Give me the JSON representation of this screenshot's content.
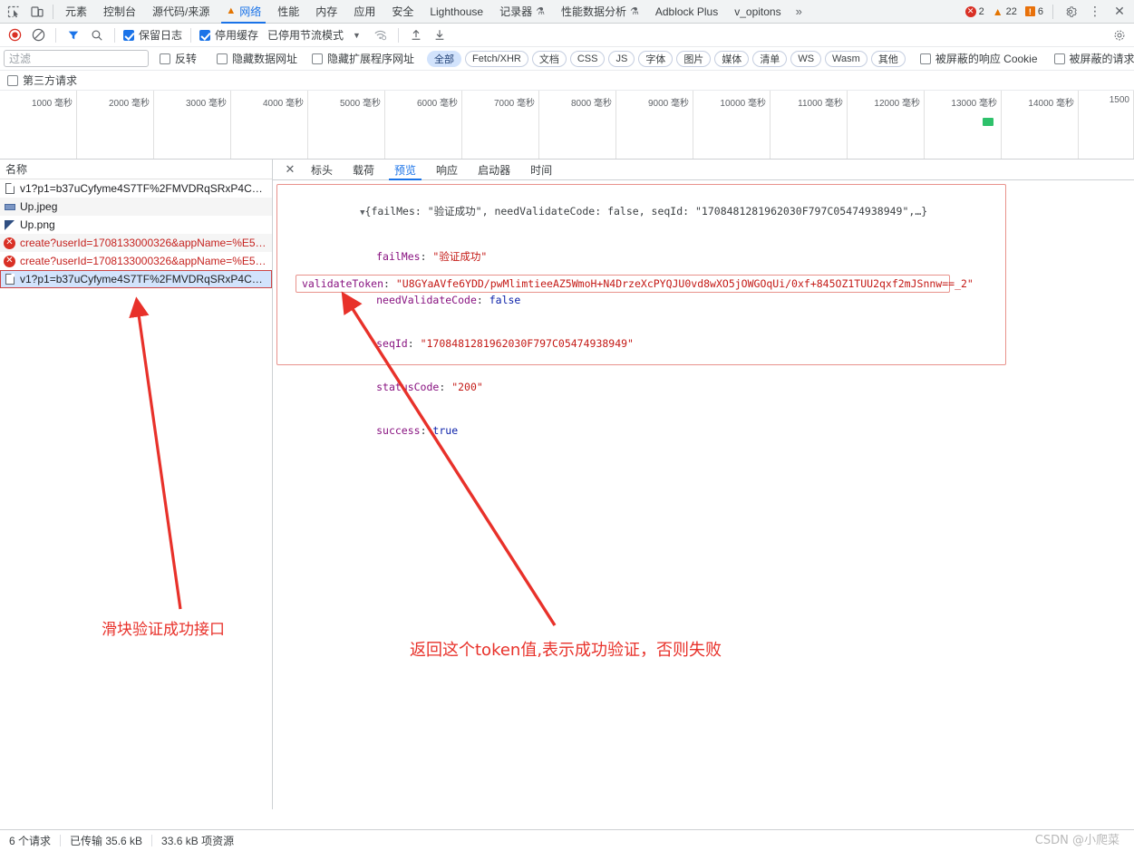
{
  "devtools_tabs": {
    "left_icons": [
      "inspect-icon",
      "device-toggle-icon"
    ],
    "items": [
      {
        "label": "元素",
        "active": false,
        "icon": null
      },
      {
        "label": "控制台",
        "active": false,
        "icon": null
      },
      {
        "label": "源代码/来源",
        "active": false,
        "icon": null
      },
      {
        "label": "网络",
        "active": true,
        "icon": "warning-triangle-icon"
      },
      {
        "label": "性能",
        "active": false,
        "icon": null
      },
      {
        "label": "内存",
        "active": false,
        "icon": null
      },
      {
        "label": "应用",
        "active": false,
        "icon": null
      },
      {
        "label": "安全",
        "active": false,
        "icon": null
      },
      {
        "label": "Lighthouse",
        "active": false,
        "icon": null
      },
      {
        "label": "记录器",
        "active": false,
        "icon": "flask-icon"
      },
      {
        "label": "性能数据分析",
        "active": false,
        "icon": "flask-icon"
      },
      {
        "label": "Adblock Plus",
        "active": false,
        "icon": null
      },
      {
        "label": "v_opitons",
        "active": false,
        "icon": null
      }
    ],
    "more_label": "»",
    "counters": {
      "errors": "2",
      "warnings": "22",
      "issues": "6"
    },
    "right_icons": [
      "gear-icon",
      "kebab-menu-icon",
      "close-icon"
    ]
  },
  "network_toolbar": {
    "record_label": "record-button",
    "clear_label": "clear-button",
    "filter_icon_label": "filter-icon",
    "search_icon_label": "search-icon",
    "preserve_log": {
      "label": "保留日志",
      "checked": true
    },
    "disable_cache": {
      "label": "停用缓存",
      "checked": true
    },
    "throttle_label": "已停用节流模式",
    "caret": "▼",
    "wifi_icon": "network-conditions-icon",
    "import_icon": "import-har-icon",
    "export_icon": "export-har-icon"
  },
  "filter_bar": {
    "filter_placeholder": "过滤",
    "filter_value": "",
    "invert": {
      "label": "反转",
      "checked": false
    },
    "hide_data_urls": {
      "label": "隐藏数据网址",
      "checked": false
    },
    "hide_ext_urls": {
      "label": "隐藏扩展程序网址",
      "checked": false
    },
    "type_chips": [
      {
        "label": "全部",
        "selected": true
      },
      {
        "label": "Fetch/XHR",
        "selected": false
      },
      {
        "label": "文档",
        "selected": false
      },
      {
        "label": "CSS",
        "selected": false
      },
      {
        "label": "JS",
        "selected": false
      },
      {
        "label": "字体",
        "selected": false
      },
      {
        "label": "图片",
        "selected": false
      },
      {
        "label": "媒体",
        "selected": false
      },
      {
        "label": "清单",
        "selected": false
      },
      {
        "label": "WS",
        "selected": false
      },
      {
        "label": "Wasm",
        "selected": false
      },
      {
        "label": "其他",
        "selected": false
      }
    ],
    "blocked_cookies": {
      "label": "被屏蔽的响应 Cookie",
      "checked": false
    },
    "blocked_requests": {
      "label": "被屏蔽的请求",
      "checked": false
    }
  },
  "third_party": {
    "label": "第三方请求",
    "checked": false
  },
  "overview": {
    "ticks": [
      "1000 毫秒",
      "2000 毫秒",
      "3000 毫秒",
      "4000 毫秒",
      "5000 毫秒",
      "6000 毫秒",
      "7000 毫秒",
      "8000 毫秒",
      "9000 毫秒",
      "10000 毫秒",
      "11000 毫秒",
      "12000 毫秒",
      "13000 毫秒",
      "14000 毫秒",
      "1500"
    ],
    "marker_color": "#2ec16b"
  },
  "request_list": {
    "column_header": "名称",
    "rows": [
      {
        "name": "v1?p1=b37uCyfyme4S7TF%2FMVDRqSRxP4CB2Bj…",
        "icon": "document-icon",
        "status": "ok",
        "selected": false
      },
      {
        "name": "Up.jpeg",
        "icon": "jpeg-image-icon",
        "status": "ok",
        "selected": false
      },
      {
        "name": "Up.png",
        "icon": "png-image-icon",
        "status": "ok",
        "selected": false
      },
      {
        "name": "create?userId=1708133000326&appName=%E5%…",
        "icon": "error-icon",
        "status": "error",
        "selected": false
      },
      {
        "name": "create?userId=1708133000326&appName=%E5%…",
        "icon": "error-icon",
        "status": "error",
        "selected": false
      },
      {
        "name": "v1?p1=b37uCyfyme4S7TF%2FMVDRqSRxP4CB2Bj…",
        "icon": "document-icon",
        "status": "ok",
        "selected": true
      }
    ]
  },
  "detail_panel": {
    "close_icon": "close-icon",
    "tabs": [
      {
        "label": "标头",
        "active": false
      },
      {
        "label": "载荷",
        "active": false
      },
      {
        "label": "预览",
        "active": true
      },
      {
        "label": "响应",
        "active": false
      },
      {
        "label": "启动器",
        "active": false
      },
      {
        "label": "时间",
        "active": false
      }
    ],
    "preview": {
      "root_collapse_triangle": "▼",
      "summary_prefix": "{",
      "summary": "{failMes: \"验证成功\", needValidateCode: false, seqId: \"1708481281962030F797C05474938949\",…}",
      "fields": [
        {
          "key": "failMes",
          "value": "\"验证成功\"",
          "type": "string"
        },
        {
          "key": "needValidateCode",
          "value": "false",
          "type": "bool"
        },
        {
          "key": "seqId",
          "value": "\"1708481281962030F797C05474938949\"",
          "type": "string"
        },
        {
          "key": "statusCode",
          "value": "\"200\"",
          "type": "string"
        },
        {
          "key": "success",
          "value": "true",
          "type": "bool"
        }
      ],
      "highlighted_field": {
        "key": "validateToken",
        "value": "\"U8GYaAVfe6YDD/pwMlimtieeAZ5WmoH+N4DrzeXcPYQJU0vd8wXO5jOWGOqUi/0xf+845OZ1TUU2qxf2mJSnnw==_2\"",
        "type": "string"
      }
    }
  },
  "annotations": {
    "left_note": "滑块验证成功接口",
    "right_note": "返回这个token值,表示成功验证，否则失败",
    "color": "#e8312a"
  },
  "status_bar": {
    "requests": "6 个请求",
    "transferred": "已传输 35.6 kB",
    "resources": "33.6 kB 项资源"
  },
  "watermark": "CSDN @小爬菜"
}
